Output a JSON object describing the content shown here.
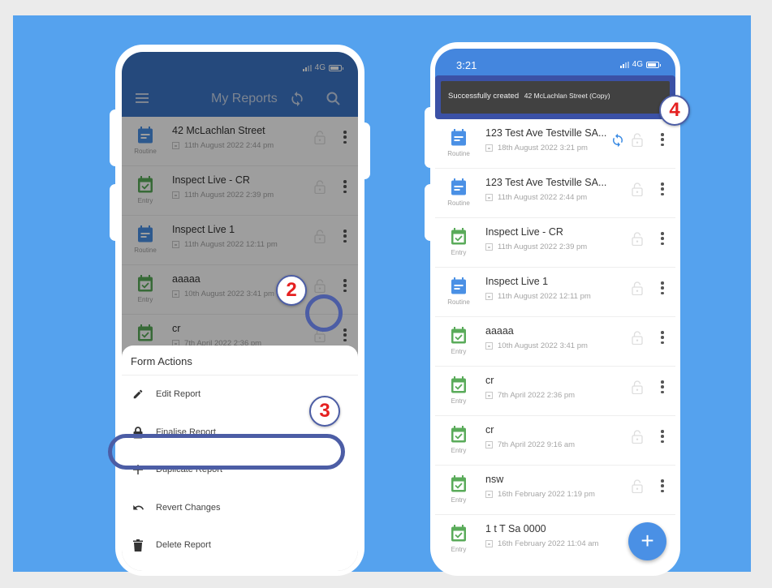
{
  "colors": {
    "background": "#ebebeb",
    "stage": "#55a2ee",
    "appbar_dim": "#26508a",
    "statusbar_active": "#4486de",
    "routine_icon": "#4a90e5",
    "entry_icon": "#5aab5a",
    "annotation_ring": "#4c5da5",
    "annotation_number": "#e52020",
    "toast_bg": "#414141",
    "fab": "#4a90e5"
  },
  "left_phone": {
    "status": {
      "network": "4G"
    },
    "appbar": {
      "title": "My Reports",
      "menu_icon": "hamburger-menu-icon",
      "sync_icon": "sync-icon",
      "search_icon": "search-icon"
    },
    "reports": [
      {
        "type": "Routine",
        "name": "42 McLachlan Street",
        "date": "11th August 2022 2:44 pm"
      },
      {
        "type": "Entry",
        "name": "Inspect Live - CR",
        "date": "11th August 2022 2:39 pm"
      },
      {
        "type": "Routine",
        "name": "Inspect Live 1",
        "date": "11th August 2022 12:11 pm"
      },
      {
        "type": "Entry",
        "name": "aaaaa",
        "date": "10th August 2022 3:41 pm"
      },
      {
        "type": "Entry",
        "name": "cr",
        "date": "7th April 2022 2:36 pm"
      }
    ],
    "form_actions": {
      "title": "Form Actions",
      "items": [
        {
          "label": "Edit Report",
          "icon": "pencil-icon"
        },
        {
          "label": "Finalise Report",
          "icon": "lock-icon"
        },
        {
          "label": "Duplicate Report",
          "icon": "plus-icon"
        },
        {
          "label": "Revert Changes",
          "icon": "undo-icon"
        },
        {
          "label": "Delete Report",
          "icon": "trash-icon"
        }
      ]
    }
  },
  "right_phone": {
    "status": {
      "time": "3:21",
      "network": "4G"
    },
    "toast": {
      "message": "Successfully created",
      "detail": "42 McLachlan Street (Copy)"
    },
    "reports": [
      {
        "type": "Routine",
        "name": "123 Test Ave Testville  SA...",
        "date": "18th August 2022 3:21 pm",
        "syncing": true
      },
      {
        "type": "Routine",
        "name": "123 Test Ave Testville  SA...",
        "date": "11th August 2022 2:44 pm"
      },
      {
        "type": "Entry",
        "name": "Inspect Live - CR",
        "date": "11th August 2022 2:39 pm"
      },
      {
        "type": "Routine",
        "name": "Inspect Live 1",
        "date": "11th August 2022 12:11 pm"
      },
      {
        "type": "Entry",
        "name": "aaaaa",
        "date": "10th August 2022 3:41 pm"
      },
      {
        "type": "Entry",
        "name": "cr",
        "date": "7th April 2022 2:36 pm"
      },
      {
        "type": "Entry",
        "name": "cr",
        "date": "7th April 2022 9:16 am"
      },
      {
        "type": "Entry",
        "name": "nsw",
        "date": "16th February 2022 1:19 pm"
      },
      {
        "type": "Entry",
        "name": "1 t T Sa  0000",
        "date": "16th February 2022 11:04 am"
      }
    ],
    "fab_label": "+"
  },
  "annotations": {
    "step2": "2",
    "step3": "3",
    "step4": "4"
  }
}
